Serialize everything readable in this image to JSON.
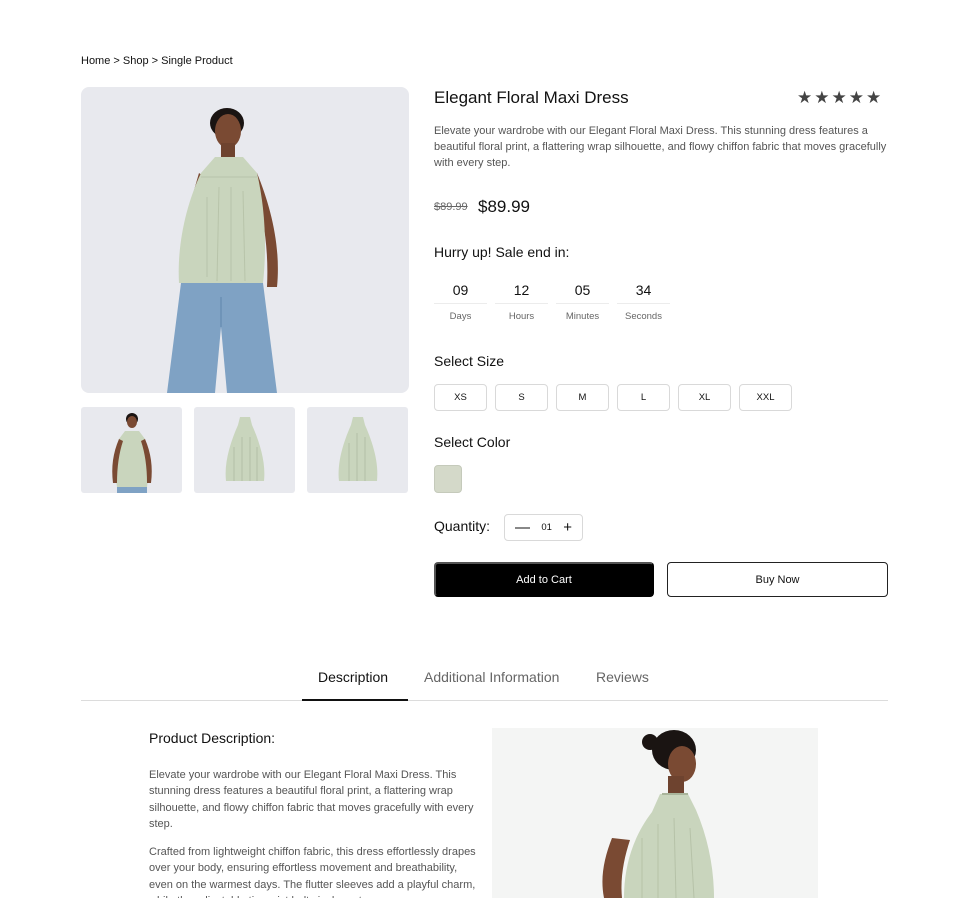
{
  "breadcrumb": "Home > Shop > Single Product",
  "product": {
    "title": "Elegant Floral Maxi Dress",
    "rating": 5,
    "stars": "★★★★★",
    "description": "Elevate your wardrobe with our Elegant Floral Maxi Dress. This stunning dress features a beautiful floral print, a flattering wrap silhouette, and flowy chiffon fabric that moves gracefully with every step.",
    "price_old": "$89.99",
    "price_new": "$89.99"
  },
  "sale": {
    "heading": "Hurry up! Sale end in:",
    "countdown": [
      {
        "value": "09",
        "label": "Days"
      },
      {
        "value": "12",
        "label": "Hours"
      },
      {
        "value": "05",
        "label": "Minutes"
      },
      {
        "value": "34",
        "label": "Seconds"
      }
    ]
  },
  "size": {
    "heading": "Select Size",
    "options": [
      "XS",
      "S",
      "M",
      "L",
      "XL",
      "XXL"
    ]
  },
  "color": {
    "heading": "Select Color",
    "swatch_color": "#d4d9c9"
  },
  "quantity": {
    "label": "Quantity:",
    "minus": "—",
    "value": "01",
    "plus": "+"
  },
  "actions": {
    "add_to_cart": "Add to Cart",
    "buy_now": "Buy Now"
  },
  "tabs": {
    "description": "Description",
    "additional": "Additional Information",
    "reviews": "Reviews",
    "active": "description"
  },
  "product_description": {
    "heading": "Product Description:",
    "paragraph1": "Elevate your wardrobe with our Elegant Floral Maxi Dress. This stunning dress features a beautiful floral print, a flattering wrap silhouette, and flowy chiffon fabric that moves gracefully with every step.",
    "paragraph2": "Crafted from lightweight chiffon fabric, this dress effortlessly drapes over your body, ensuring effortless movement and breathability, even on the warmest days. The flutter sleeves add a playful charm, while the adjustable tie waist belt cinches at"
  },
  "colors": {
    "image_bg": "#e8e9ee",
    "top_color": "#c9d5bd",
    "jeans_color": "#7fa2c4",
    "skin": "#7a4a33",
    "hair": "#1a1412"
  }
}
